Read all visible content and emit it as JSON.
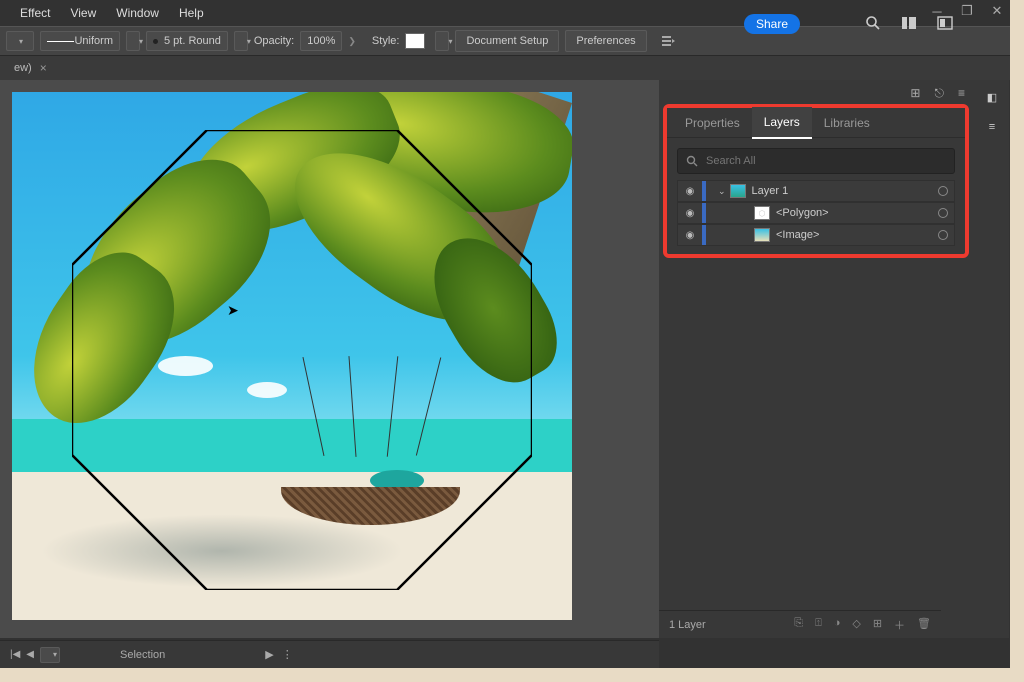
{
  "menu": {
    "effect": "Effect",
    "view": "View",
    "window": "Window",
    "help": "Help"
  },
  "share_label": "Share",
  "toolbar": {
    "stroke_style": "Uniform",
    "stroke_weight": "5 pt. Round",
    "opacity_label": "Opacity:",
    "opacity_value": "100%",
    "style_label": "Style:",
    "doc_setup": "Document Setup",
    "preferences": "Preferences"
  },
  "doc_tab": {
    "name": "ew)"
  },
  "status": {
    "tool": "Selection"
  },
  "panel": {
    "tabs": {
      "properties": "Properties",
      "layers": "Layers",
      "libraries": "Libraries"
    },
    "search_placeholder": "Search All",
    "layers": [
      {
        "name": "Layer 1"
      },
      {
        "name": "<Polygon>"
      },
      {
        "name": "<Image>"
      }
    ],
    "footer_count": "1 Layer"
  }
}
